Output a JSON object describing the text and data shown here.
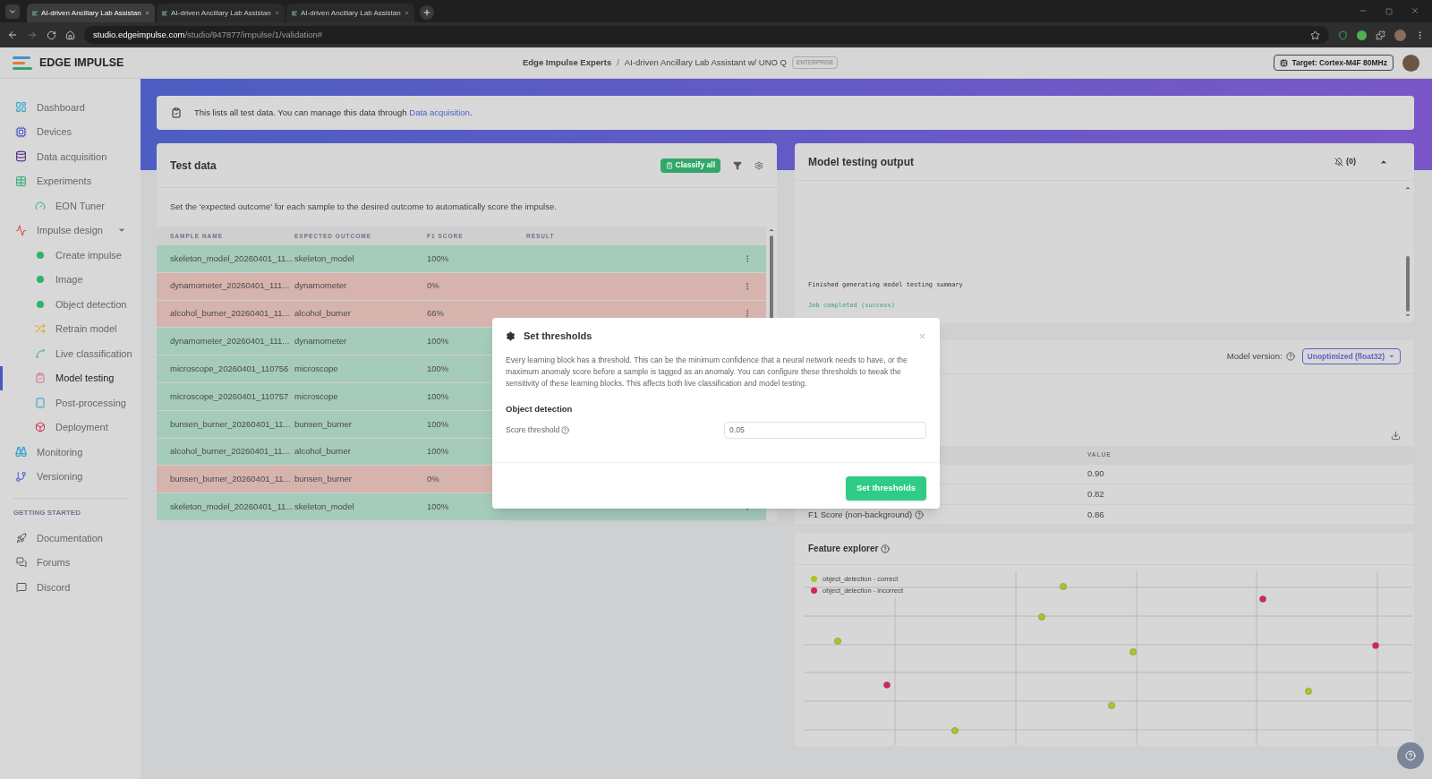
{
  "browser": {
    "tabs": [
      {
        "title": "AI-driven Ancillary Lab Assistan",
        "selected": true
      },
      {
        "title": "AI-driven Ancillary Lab Assistan",
        "selected": false
      },
      {
        "title": "AI-driven Ancillary Lab Assistan",
        "selected": false
      }
    ],
    "url_host": "studio.edgeimpulse.com",
    "url_path": "/studio/947877/impulse/1/validation#"
  },
  "header": {
    "logo": "EDGE IMPULSE",
    "breadcrumb": [
      "Edge Impulse Experts",
      "AI-driven Ancillary Lab Assistant w/ UNO Q"
    ],
    "separator": "/",
    "badge": "ENTERPRISE",
    "target": "Target: Cortex-M4F 80MHz"
  },
  "sidebar": {
    "items": [
      {
        "label": "Dashboard",
        "selected": false
      },
      {
        "label": "Devices",
        "selected": false
      },
      {
        "label": "Data acquisition",
        "selected": false
      },
      {
        "label": "Experiments",
        "selected": false,
        "children": [
          {
            "label": "EON Tuner",
            "selected": false
          }
        ]
      },
      {
        "label": "Impulse design",
        "selected": false,
        "expanded": true,
        "children": [
          {
            "label": "Create impulse",
            "selected": false
          },
          {
            "label": "Image",
            "selected": false
          },
          {
            "label": "Object detection",
            "selected": false
          },
          {
            "label": "Retrain model",
            "selected": false
          },
          {
            "label": "Live classification",
            "selected": false
          },
          {
            "label": "Model testing",
            "selected": true
          },
          {
            "label": "Post-processing",
            "selected": false
          },
          {
            "label": "Deployment",
            "selected": false
          }
        ]
      },
      {
        "label": "Monitoring",
        "selected": false
      },
      {
        "label": "Versioning",
        "selected": false
      }
    ],
    "section_title": "GETTING STARTED",
    "links": [
      "Documentation",
      "Forums",
      "Discord"
    ]
  },
  "info_bar": {
    "text": "This lists all test data. You can manage this data through ",
    "link": "Data acquisition",
    "end": "."
  },
  "test_data": {
    "title": "Test data",
    "classify_button": "Classify all",
    "description": "Set the 'expected outcome' for each sample to the desired outcome to automatically score the impulse.",
    "columns": [
      "SAMPLE NAME",
      "EXPECTED OUTCOME",
      "F1 SCORE",
      "RESULT"
    ],
    "rows": [
      {
        "name": "skeleton_model_20260401_11...",
        "expected": "skeleton_model",
        "f1": "100%",
        "correct": true,
        "menu": true
      },
      {
        "name": "dynamometer_20260401_111...",
        "expected": "dynamometer",
        "f1": "0%",
        "correct": false,
        "menu": true
      },
      {
        "name": "alcohol_burner_20260401_11...",
        "expected": "alcohol_burner",
        "f1": "66%",
        "correct": false,
        "menu": true
      },
      {
        "name": "dynamometer_20260401_111...",
        "expected": "dynamometer",
        "f1": "100%",
        "correct": true
      },
      {
        "name": "microscope_20260401_110756",
        "expected": "microscope",
        "f1": "100%",
        "correct": true
      },
      {
        "name": "microscope_20260401_110757",
        "expected": "microscope",
        "f1": "100%",
        "correct": true
      },
      {
        "name": "bunsen_burner_20260401_11...",
        "expected": "bunsen_burner",
        "f1": "100%",
        "correct": true
      },
      {
        "name": "alcohol_burner_20260401_11...",
        "expected": "alcohol_burner",
        "f1": "100%",
        "correct": true
      },
      {
        "name": "bunsen_burner_20260401_11...",
        "expected": "bunsen_burner",
        "f1": "0%",
        "correct": false
      },
      {
        "name": "skeleton_model_20260401_11...",
        "expected": "skeleton_model",
        "f1": "100%",
        "correct": true,
        "menu": true
      }
    ]
  },
  "output": {
    "title": "Model testing output",
    "notifications": "(0)",
    "log": [
      {
        "text": "Finished generating model testing summary",
        "kind": "info"
      },
      {
        "text": "Job completed (success)",
        "kind": "success"
      }
    ]
  },
  "results": {
    "model_version_label": "Model version:",
    "model_version": "Unoptimized (float32)",
    "value_column": "VALUE",
    "metrics": [
      {
        "value": "0.90"
      },
      {
        "value": "0.82"
      },
      {
        "label": "F1 Score (non-background)",
        "value": "0.86"
      }
    ]
  },
  "feature_explorer": {
    "title": "Feature explorer",
    "legend": [
      {
        "label": "object_detection - correct",
        "color": "#a8c81e"
      },
      {
        "label": "object_detection - incorrect",
        "color": "#d3245c"
      }
    ]
  },
  "modal": {
    "title": "Set thresholds",
    "body": "Every learning block has a threshold. This can be the minimum confidence that a neural network needs to have, or the maximum anomaly score before a sample is tagged as an anomaly. You can configure these thresholds to tweak the sensitivity of these learning blocks. This affects both live classification and model testing.",
    "section": "Object detection",
    "field_label": "Score threshold",
    "field_value": "0.05",
    "button": "Set thresholds"
  }
}
